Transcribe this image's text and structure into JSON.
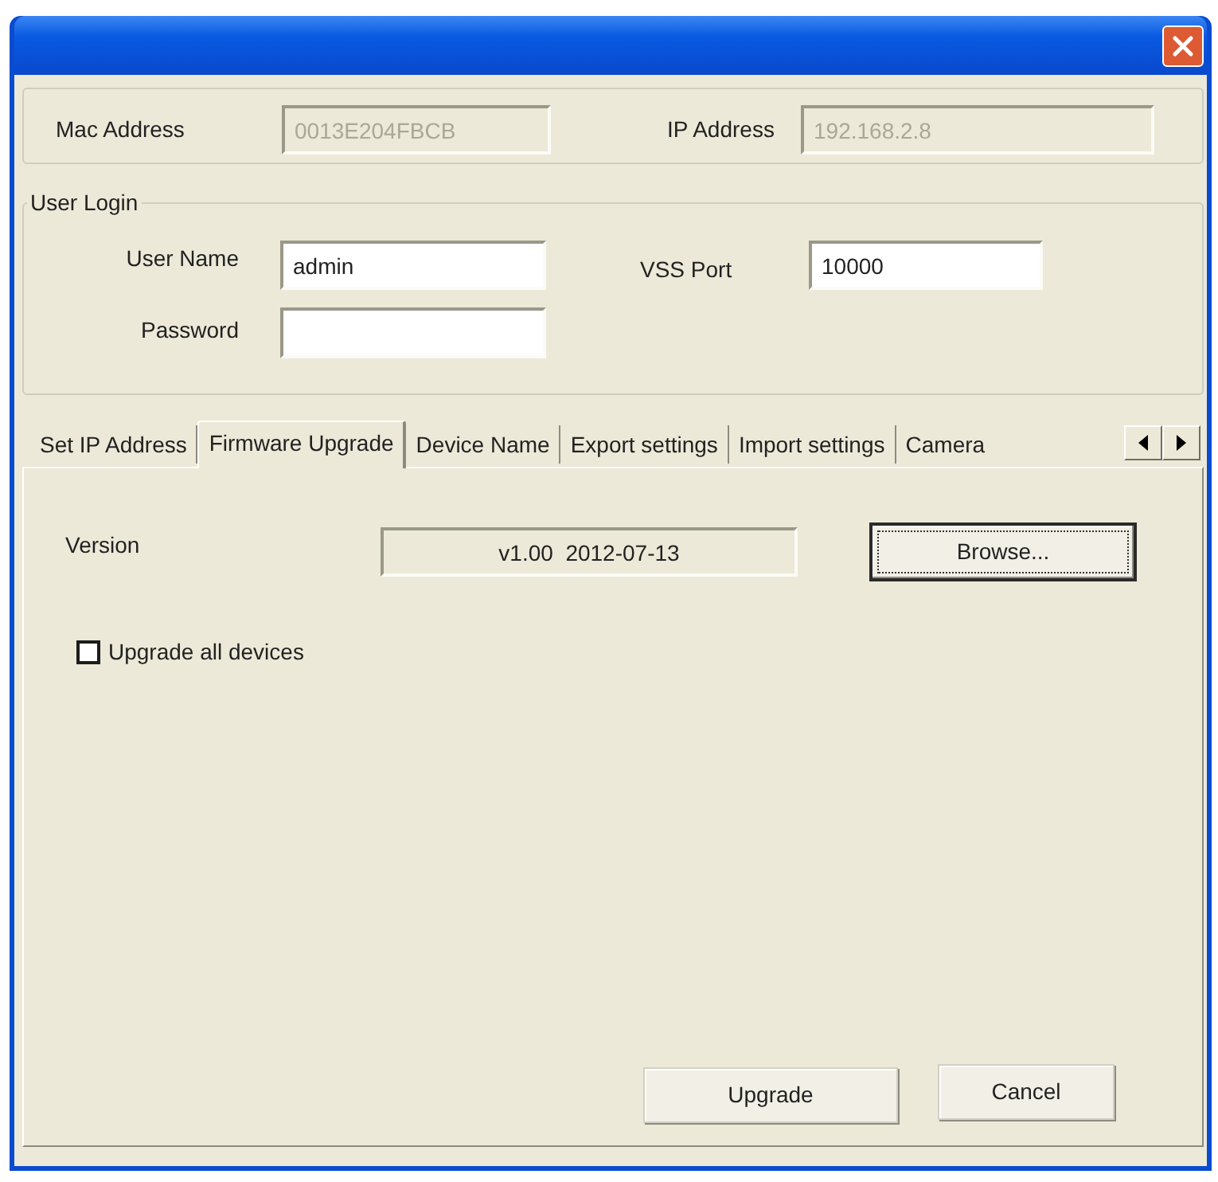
{
  "device_info": {
    "fields": [
      {
        "label": "Mac Address",
        "value": "0013E204FBCB",
        "disabled": true
      },
      {
        "label": "IP Address",
        "value": "192.168.2.8",
        "disabled": true
      }
    ]
  },
  "user_login": {
    "legend": "User Login",
    "user_name": {
      "label": "User Name",
      "value": "admin"
    },
    "password": {
      "label": "Password"
    },
    "vss_port": {
      "label": "VSS Port",
      "value": "10000"
    }
  },
  "tabs": [
    {
      "label": "Set IP Address",
      "selected": false
    },
    {
      "label": "Firmware Upgrade",
      "selected": true
    },
    {
      "label": "Device Name",
      "selected": false
    },
    {
      "label": "Export settings",
      "selected": false
    },
    {
      "label": "Import settings",
      "selected": false
    },
    {
      "label": "Camera",
      "selected": false
    }
  ],
  "firmware_panel": {
    "version": {
      "label": "Version",
      "value": "v1.00  2012-07-13",
      "read_only": true
    },
    "browse_button": {
      "label": "Browse...",
      "focused": true
    },
    "upgrade_all": {
      "label": "Upgrade all devices",
      "checked": false
    }
  },
  "buttons": [
    {
      "label": "Upgrade"
    },
    {
      "label": "Cancel"
    }
  ]
}
